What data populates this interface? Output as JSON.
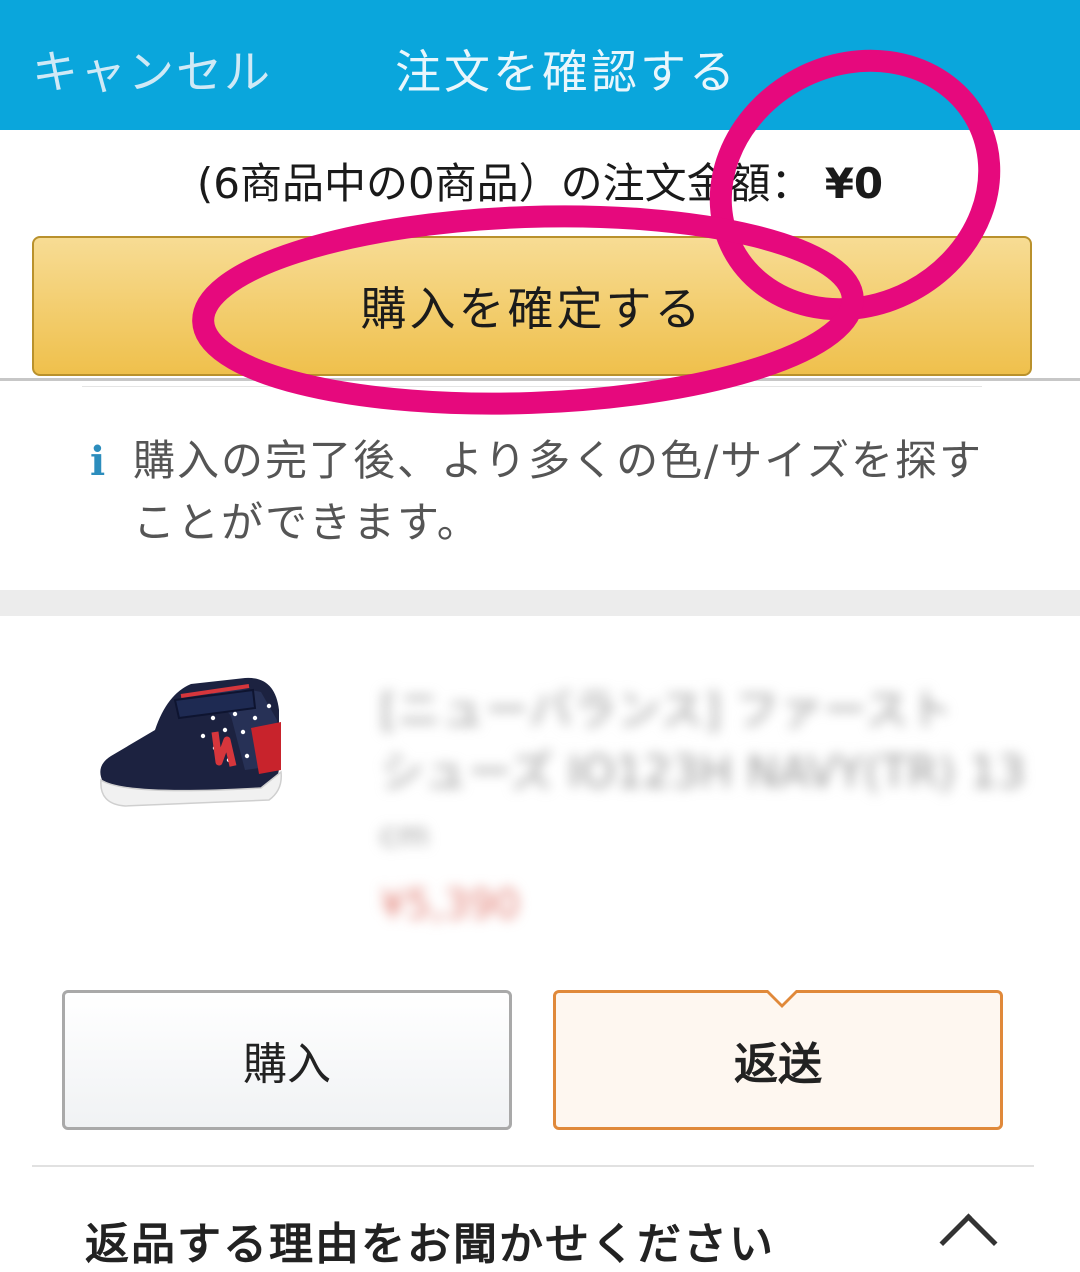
{
  "header": {
    "cancel_label": "キャンセル",
    "title": "注文を確認する",
    "background_color": "#0aa6dc"
  },
  "summary": {
    "label": "(6商品中の0商品）の注文金額：",
    "amount": "¥0"
  },
  "confirm_button": {
    "label": "購入を確定する",
    "color": "#efc04c"
  },
  "info": {
    "icon": "info-icon",
    "icon_glyph": "i",
    "text": "購入の完了後、より多くの色/サイズを探すことができます。"
  },
  "product": {
    "image_icon": "baby-shoe-icon",
    "title_line1": "[ニューバランス] ファースト",
    "title_line2": "シューズ IO123H NAVY(TR) 13",
    "size_unit": "cm",
    "price": "¥5,390",
    "blurred": true
  },
  "actions": {
    "purchase_label": "購入",
    "return_label": "返送",
    "return_selected": true,
    "accent_color": "#e0893a"
  },
  "return_reason": {
    "label": "返品する理由をお聞かせください",
    "chevron_icon": "chevron-up-icon"
  },
  "annotations": {
    "highlight_color": "#e6097d"
  }
}
